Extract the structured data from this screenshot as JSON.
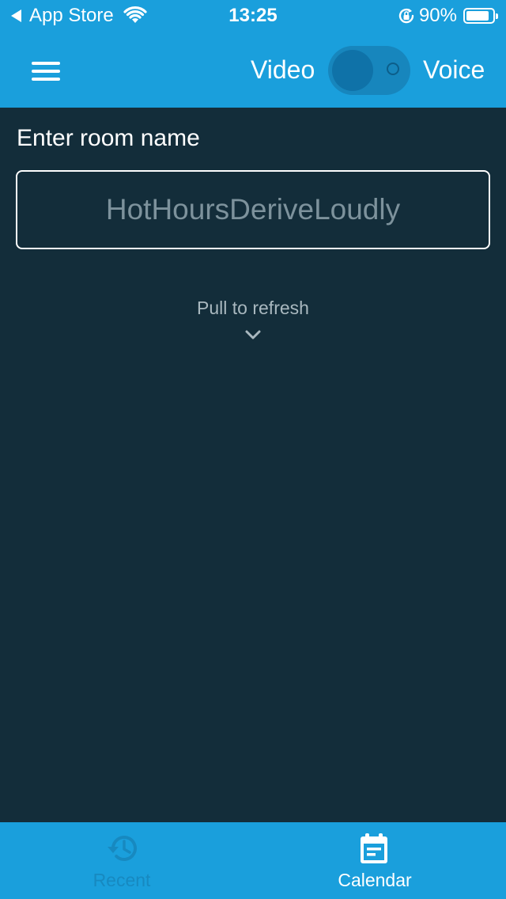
{
  "status_bar": {
    "back_label": "App Store",
    "time": "13:25",
    "battery_percent": "90%",
    "battery_level": 0.9,
    "icons": [
      "back-triangle-icon",
      "wifi-icon",
      "rotation-lock-icon",
      "battery-icon"
    ]
  },
  "header": {
    "menu_icon": "hamburger-menu-icon",
    "video_label": "Video",
    "voice_label": "Voice",
    "toggle_state": "video"
  },
  "main": {
    "room_label": "Enter room name",
    "room_input": {
      "value": "",
      "placeholder": "HotHoursDeriveLoudly"
    },
    "pull_to_refresh": "Pull to refresh",
    "chevron_icon": "chevron-down-icon"
  },
  "tab_bar": {
    "tabs": [
      {
        "label": "Recent",
        "icon": "history-icon",
        "active": false
      },
      {
        "label": "Calendar",
        "icon": "calendar-icon",
        "active": true
      }
    ]
  },
  "colors": {
    "brand_blue": "#1a9fdc",
    "background": "#132d3a",
    "inactive_tab": "#1789c0",
    "placeholder": "#7d929c"
  }
}
